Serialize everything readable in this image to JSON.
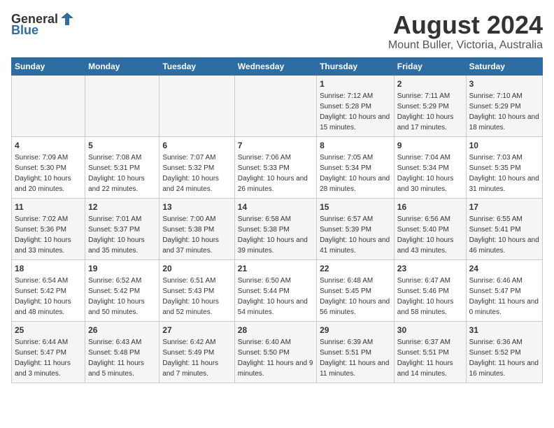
{
  "header": {
    "logo_general": "General",
    "logo_blue": "Blue",
    "title": "August 2024",
    "subtitle": "Mount Buller, Victoria, Australia"
  },
  "weekdays": [
    "Sunday",
    "Monday",
    "Tuesday",
    "Wednesday",
    "Thursday",
    "Friday",
    "Saturday"
  ],
  "weeks": [
    [
      {
        "day": "",
        "sunrise": "",
        "sunset": "",
        "daylight": ""
      },
      {
        "day": "",
        "sunrise": "",
        "sunset": "",
        "daylight": ""
      },
      {
        "day": "",
        "sunrise": "",
        "sunset": "",
        "daylight": ""
      },
      {
        "day": "",
        "sunrise": "",
        "sunset": "",
        "daylight": ""
      },
      {
        "day": "1",
        "sunrise": "Sunrise: 7:12 AM",
        "sunset": "Sunset: 5:28 PM",
        "daylight": "Daylight: 10 hours and 15 minutes."
      },
      {
        "day": "2",
        "sunrise": "Sunrise: 7:11 AM",
        "sunset": "Sunset: 5:29 PM",
        "daylight": "Daylight: 10 hours and 17 minutes."
      },
      {
        "day": "3",
        "sunrise": "Sunrise: 7:10 AM",
        "sunset": "Sunset: 5:29 PM",
        "daylight": "Daylight: 10 hours and 18 minutes."
      }
    ],
    [
      {
        "day": "4",
        "sunrise": "Sunrise: 7:09 AM",
        "sunset": "Sunset: 5:30 PM",
        "daylight": "Daylight: 10 hours and 20 minutes."
      },
      {
        "day": "5",
        "sunrise": "Sunrise: 7:08 AM",
        "sunset": "Sunset: 5:31 PM",
        "daylight": "Daylight: 10 hours and 22 minutes."
      },
      {
        "day": "6",
        "sunrise": "Sunrise: 7:07 AM",
        "sunset": "Sunset: 5:32 PM",
        "daylight": "Daylight: 10 hours and 24 minutes."
      },
      {
        "day": "7",
        "sunrise": "Sunrise: 7:06 AM",
        "sunset": "Sunset: 5:33 PM",
        "daylight": "Daylight: 10 hours and 26 minutes."
      },
      {
        "day": "8",
        "sunrise": "Sunrise: 7:05 AM",
        "sunset": "Sunset: 5:34 PM",
        "daylight": "Daylight: 10 hours and 28 minutes."
      },
      {
        "day": "9",
        "sunrise": "Sunrise: 7:04 AM",
        "sunset": "Sunset: 5:34 PM",
        "daylight": "Daylight: 10 hours and 30 minutes."
      },
      {
        "day": "10",
        "sunrise": "Sunrise: 7:03 AM",
        "sunset": "Sunset: 5:35 PM",
        "daylight": "Daylight: 10 hours and 31 minutes."
      }
    ],
    [
      {
        "day": "11",
        "sunrise": "Sunrise: 7:02 AM",
        "sunset": "Sunset: 5:36 PM",
        "daylight": "Daylight: 10 hours and 33 minutes."
      },
      {
        "day": "12",
        "sunrise": "Sunrise: 7:01 AM",
        "sunset": "Sunset: 5:37 PM",
        "daylight": "Daylight: 10 hours and 35 minutes."
      },
      {
        "day": "13",
        "sunrise": "Sunrise: 7:00 AM",
        "sunset": "Sunset: 5:38 PM",
        "daylight": "Daylight: 10 hours and 37 minutes."
      },
      {
        "day": "14",
        "sunrise": "Sunrise: 6:58 AM",
        "sunset": "Sunset: 5:38 PM",
        "daylight": "Daylight: 10 hours and 39 minutes."
      },
      {
        "day": "15",
        "sunrise": "Sunrise: 6:57 AM",
        "sunset": "Sunset: 5:39 PM",
        "daylight": "Daylight: 10 hours and 41 minutes."
      },
      {
        "day": "16",
        "sunrise": "Sunrise: 6:56 AM",
        "sunset": "Sunset: 5:40 PM",
        "daylight": "Daylight: 10 hours and 43 minutes."
      },
      {
        "day": "17",
        "sunrise": "Sunrise: 6:55 AM",
        "sunset": "Sunset: 5:41 PM",
        "daylight": "Daylight: 10 hours and 46 minutes."
      }
    ],
    [
      {
        "day": "18",
        "sunrise": "Sunrise: 6:54 AM",
        "sunset": "Sunset: 5:42 PM",
        "daylight": "Daylight: 10 hours and 48 minutes."
      },
      {
        "day": "19",
        "sunrise": "Sunrise: 6:52 AM",
        "sunset": "Sunset: 5:42 PM",
        "daylight": "Daylight: 10 hours and 50 minutes."
      },
      {
        "day": "20",
        "sunrise": "Sunrise: 6:51 AM",
        "sunset": "Sunset: 5:43 PM",
        "daylight": "Daylight: 10 hours and 52 minutes."
      },
      {
        "day": "21",
        "sunrise": "Sunrise: 6:50 AM",
        "sunset": "Sunset: 5:44 PM",
        "daylight": "Daylight: 10 hours and 54 minutes."
      },
      {
        "day": "22",
        "sunrise": "Sunrise: 6:48 AM",
        "sunset": "Sunset: 5:45 PM",
        "daylight": "Daylight: 10 hours and 56 minutes."
      },
      {
        "day": "23",
        "sunrise": "Sunrise: 6:47 AM",
        "sunset": "Sunset: 5:46 PM",
        "daylight": "Daylight: 10 hours and 58 minutes."
      },
      {
        "day": "24",
        "sunrise": "Sunrise: 6:46 AM",
        "sunset": "Sunset: 5:47 PM",
        "daylight": "Daylight: 11 hours and 0 minutes."
      }
    ],
    [
      {
        "day": "25",
        "sunrise": "Sunrise: 6:44 AM",
        "sunset": "Sunset: 5:47 PM",
        "daylight": "Daylight: 11 hours and 3 minutes."
      },
      {
        "day": "26",
        "sunrise": "Sunrise: 6:43 AM",
        "sunset": "Sunset: 5:48 PM",
        "daylight": "Daylight: 11 hours and 5 minutes."
      },
      {
        "day": "27",
        "sunrise": "Sunrise: 6:42 AM",
        "sunset": "Sunset: 5:49 PM",
        "daylight": "Daylight: 11 hours and 7 minutes."
      },
      {
        "day": "28",
        "sunrise": "Sunrise: 6:40 AM",
        "sunset": "Sunset: 5:50 PM",
        "daylight": "Daylight: 11 hours and 9 minutes."
      },
      {
        "day": "29",
        "sunrise": "Sunrise: 6:39 AM",
        "sunset": "Sunset: 5:51 PM",
        "daylight": "Daylight: 11 hours and 11 minutes."
      },
      {
        "day": "30",
        "sunrise": "Sunrise: 6:37 AM",
        "sunset": "Sunset: 5:51 PM",
        "daylight": "Daylight: 11 hours and 14 minutes."
      },
      {
        "day": "31",
        "sunrise": "Sunrise: 6:36 AM",
        "sunset": "Sunset: 5:52 PM",
        "daylight": "Daylight: 11 hours and 16 minutes."
      }
    ]
  ]
}
